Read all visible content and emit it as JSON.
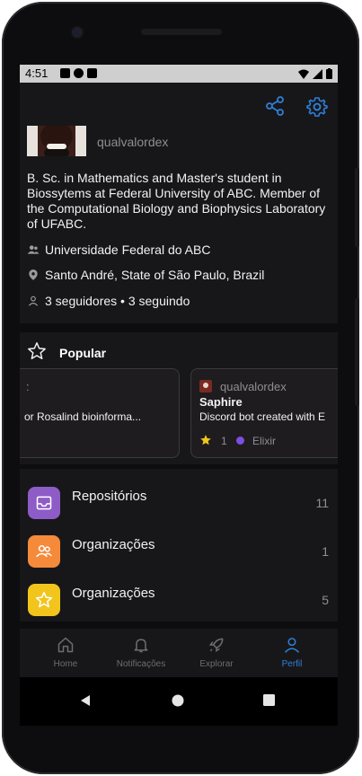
{
  "status": {
    "time": "4:51"
  },
  "profile": {
    "username": "qualvalordex",
    "bio": "B. Sc. in Mathematics and Master's student in Biossytems at Federal University of ABC. Member of the Computational Biology and Biophysics Laboratory of UFABC.",
    "company": "Universidade Federal do ABC",
    "location": "Santo André, State of São Paulo, Brazil",
    "follow": "3 seguidores • 3 seguindo"
  },
  "popular": {
    "title": "Popular",
    "cards": [
      {
        "description": "or Rosalind bioinforma..."
      },
      {
        "owner": "qualvalordex",
        "name": "Saphire",
        "description": "Discord bot created with E",
        "stars": "1",
        "language": "Elixir",
        "language_color": "#6e4a7e"
      }
    ]
  },
  "menu": [
    {
      "label": "Repositórios",
      "count": "11",
      "color": "#8e5cc7",
      "icon": "repo-icon"
    },
    {
      "label": "Organizações",
      "count": "1",
      "color": "#f58a3a",
      "icon": "people-icon"
    },
    {
      "label": "Organizações",
      "count": "5",
      "color": "#f2c51c",
      "icon": "star-icon"
    }
  ],
  "nav": [
    {
      "label": "Home",
      "icon": "home-icon"
    },
    {
      "label": "Notificações",
      "icon": "bell-icon"
    },
    {
      "label": "Explorar",
      "icon": "rocket-icon"
    },
    {
      "label": "Perfil",
      "icon": "person-icon",
      "active_color": "#2f7fd6"
    }
  ]
}
